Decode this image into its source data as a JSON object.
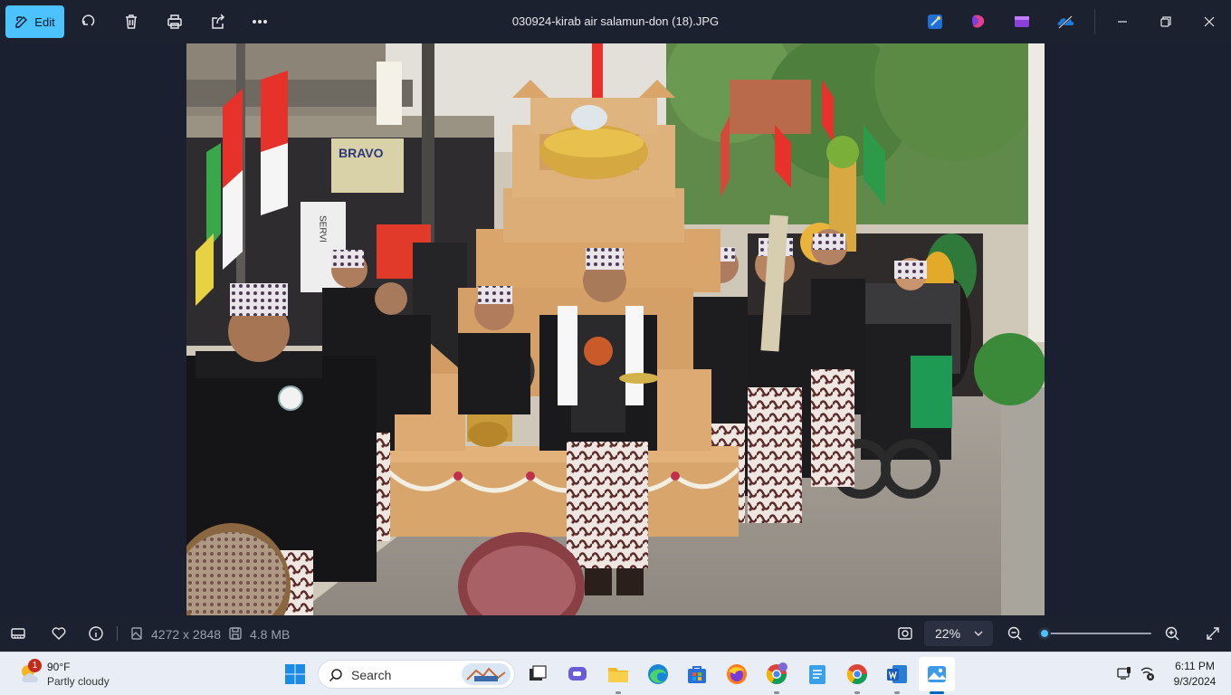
{
  "toolbar": {
    "edit_label": "Edit",
    "file_name": "030924-kirab air salamun-don (18).JPG",
    "icons": [
      "edit-icon",
      "rotate-icon",
      "delete-icon",
      "print-icon",
      "share-icon",
      "more-icon"
    ],
    "apps": [
      "designer-icon",
      "clipchamp-icon",
      "video-editor-icon",
      "onedrive-icon"
    ],
    "window_controls": [
      "minimize-icon",
      "restore-icon",
      "close-icon"
    ]
  },
  "photo": {
    "sign_shop": "BRAVO",
    "sign_vertical": "SERVI",
    "accent": "#4cc2ff"
  },
  "infobar": {
    "dimensions": "4272 x 2848",
    "file_size": "4.8 MB",
    "zoom": "22%",
    "zoom_level": 0.0
  },
  "taskbar": {
    "weather_temp": "90°F",
    "weather_desc": "Partly cloudy",
    "weather_badge": "1",
    "search_placeholder": "Search",
    "time": "6:11 PM",
    "date": "9/3/2024"
  }
}
